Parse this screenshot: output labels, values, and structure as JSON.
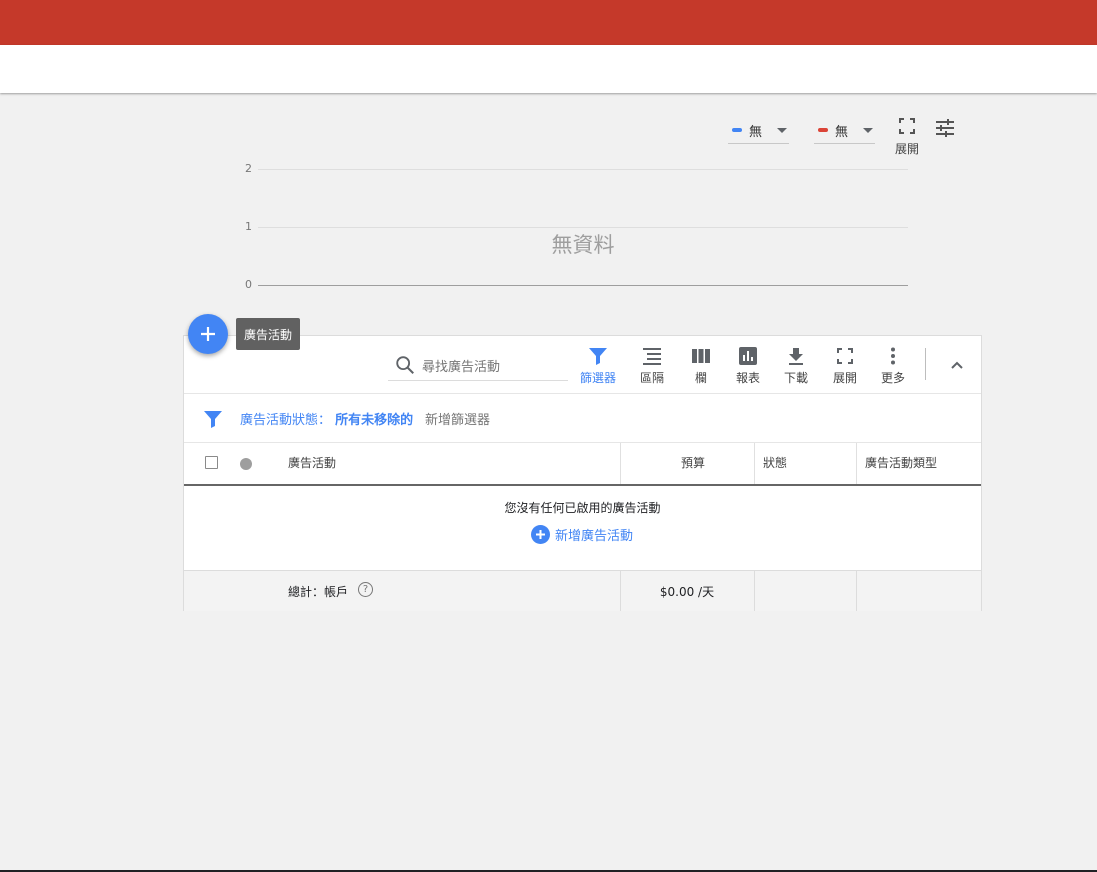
{
  "chart": {
    "metric1": {
      "label": "無",
      "color": "#4285f4"
    },
    "metric2": {
      "label": "無",
      "color": "#db4437"
    },
    "expand_label": "展開",
    "no_data": "無資料"
  },
  "chart_data": {
    "type": "line",
    "title": "",
    "xlabel": "",
    "ylabel": "",
    "ylim": [
      0,
      2
    ],
    "y_ticks": [
      "2",
      "1",
      "0"
    ],
    "series": [],
    "no_data_text": "無資料"
  },
  "fab": {
    "tooltip": "廣告活動"
  },
  "table": {
    "search_placeholder": "尋找廣告活動",
    "toolbar": {
      "filter": "篩選器",
      "segment": "區隔",
      "columns": "欄",
      "reports": "報表",
      "download": "下載",
      "expand": "展開",
      "more": "更多"
    },
    "filter_row": {
      "label": "廣告活動狀態：",
      "value": "所有未移除的",
      "add_filter": "新增篩選器"
    },
    "headers": {
      "campaign": "廣告活動",
      "budget": "預算",
      "status": "狀態",
      "type": "廣告活動類型"
    },
    "empty_message": "您沒有任何已啟用的廣告活動",
    "new_campaign": "新增廣告活動",
    "total": {
      "label": "總計：帳戶",
      "budget": "$0.00 /天"
    }
  }
}
